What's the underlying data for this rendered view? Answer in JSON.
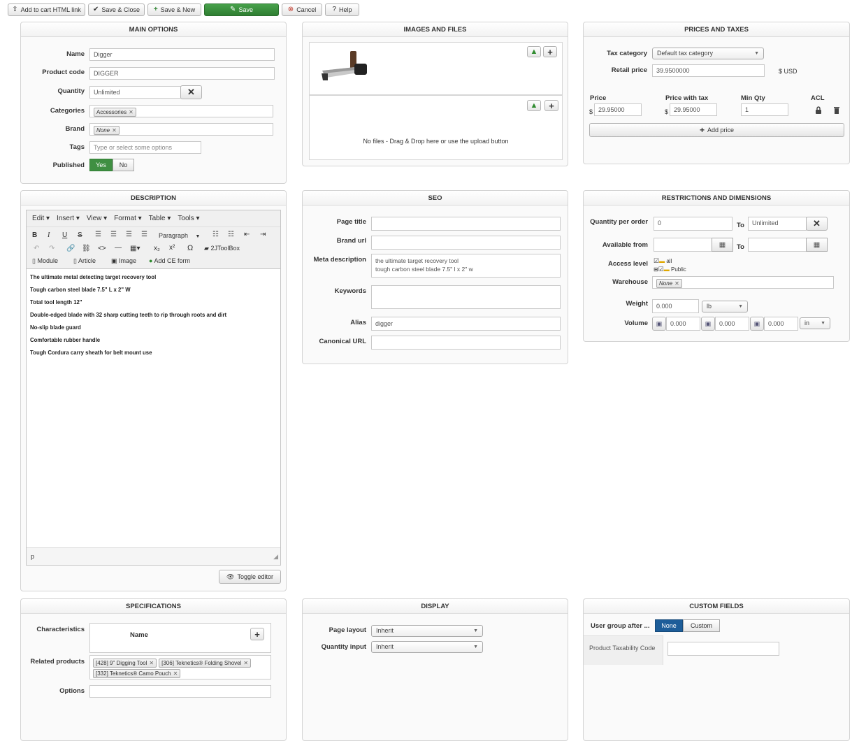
{
  "toolbar": {
    "add_to_cart": "Add to cart HTML link",
    "save_close": "Save & Close",
    "save_new": "Save & New",
    "save": "Save",
    "cancel": "Cancel",
    "help": "Help"
  },
  "main_options": {
    "title": "MAIN OPTIONS",
    "name_label": "Name",
    "name_value": "Digger",
    "code_label": "Product code",
    "code_value": "DIGGER",
    "qty_label": "Quantity",
    "qty_value": "Unlimited",
    "cat_label": "Categories",
    "cat_chip": "Accessories",
    "brand_label": "Brand",
    "brand_chip": "None",
    "tags_label": "Tags",
    "tags_placeholder": "Type or select some options",
    "published_label": "Published",
    "yes": "Yes",
    "no": "No"
  },
  "images": {
    "title": "IMAGES AND FILES",
    "no_files": "No files - Drag & Drop here or use the upload button"
  },
  "prices": {
    "title": "PRICES AND TAXES",
    "tax_label": "Tax category",
    "tax_value": "Default tax category",
    "retail_label": "Retail price",
    "retail_value": "39.9500000",
    "currency": "$ USD",
    "price_h": "Price",
    "price_tax_h": "Price with tax",
    "min_qty_h": "Min Qty",
    "acl_h": "ACL",
    "dollar": "$",
    "price_value": "29.95000",
    "price_tax_value": "29.95000",
    "min_qty_value": "1",
    "add_price": "Add price"
  },
  "description": {
    "title": "DESCRIPTION",
    "menu": [
      "Edit",
      "Insert",
      "View",
      "Format",
      "Table",
      "Tools"
    ],
    "paragraph": "Paragraph",
    "jtoolbox": "2JToolBox",
    "module": "Module",
    "article": "Article",
    "image": "Image",
    "ce_form": "Add CE form",
    "lines": [
      "The ultimate metal detecting target recovery tool",
      "Tough carbon steel blade 7.5\" L x 2\" W",
      "Total tool length 12\"",
      "Double-edged blade with 32 sharp cutting teeth to rip through roots and dirt",
      "No-slip blade guard",
      "Comfortable rubber handle",
      "Tough Cordura carry sheath for belt mount use"
    ],
    "status": "p",
    "toggle": "Toggle editor"
  },
  "seo": {
    "title": "SEO",
    "page_title_label": "Page title",
    "brand_url_label": "Brand url",
    "meta_label": "Meta description",
    "meta_line1": "the ultimate target recovery tool",
    "meta_line2": "tough carbon steel blade 7.5\" l x 2\" w",
    "keywords_label": "Keywords",
    "alias_label": "Alias",
    "alias_value": "digger",
    "canonical_label": "Canonical URL"
  },
  "restrictions": {
    "title": "RESTRICTIONS AND DIMENSIONS",
    "qpo_label": "Quantity per order",
    "qpo_value": "0",
    "to": "To",
    "qpo_to_value": "Unlimited",
    "avail_label": "Available from",
    "access_label": "Access level",
    "access_all": "all",
    "access_public": "Public",
    "warehouse_label": "Warehouse",
    "warehouse_chip": "None",
    "weight_label": "Weight",
    "weight_value": "0.000",
    "weight_unit": "lb",
    "volume_label": "Volume",
    "vol1": "0.000",
    "vol2": "0.000",
    "vol3": "0.000",
    "vol_unit": "in"
  },
  "specs": {
    "title": "SPECIFICATIONS",
    "char_label": "Characteristics",
    "name_col": "Name",
    "related_label": "Related products",
    "related": [
      "[428] 9\" Digging Tool",
      "[306] Teknetics® Folding Shovel",
      "[332] Teknetics® Camo Pouch"
    ],
    "options_label": "Options"
  },
  "display": {
    "title": "DISPLAY",
    "layout_label": "Page layout",
    "layout_value": "Inherit",
    "qty_input_label": "Quantity input",
    "qty_input_value": "Inherit"
  },
  "custom": {
    "title": "CUSTOM FIELDS",
    "user_group_label": "User group after ...",
    "none": "None",
    "custom": "Custom",
    "tax_code_label": "Product Taxability Code"
  },
  "colors": {
    "green": "#3f8f42",
    "blue": "#1d5d99"
  }
}
